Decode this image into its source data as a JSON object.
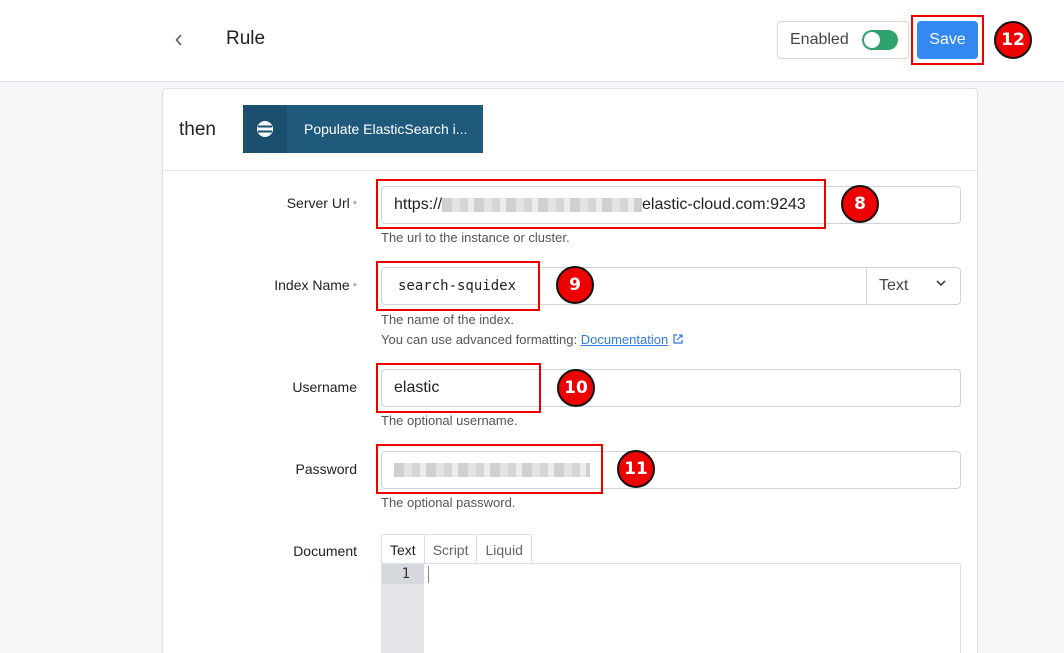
{
  "header": {
    "back_icon": "chevron-left-icon",
    "title": "Rule",
    "enabled_label": "Enabled",
    "enabled": true,
    "save_label": "Save"
  },
  "card": {
    "then_label": "then",
    "action_label": "Populate ElasticSearch i...",
    "action_icon": "elasticsearch-icon",
    "action_color": "#1f5a7c"
  },
  "fields": {
    "server_url": {
      "label": "Server Url",
      "required": "*",
      "value_prefix": "https://",
      "value_suffix": "elastic-cloud.com:9243",
      "hint": "The url to the instance or cluster."
    },
    "index_name": {
      "label": "Index Name",
      "required": "*",
      "value": "search-squidex",
      "type": "Text",
      "hint": "The name of the index.",
      "hint2": "You can use advanced formatting:",
      "doc_link": "Documentation"
    },
    "username": {
      "label": "Username",
      "value": "elastic",
      "hint": "The optional username."
    },
    "password": {
      "label": "Password",
      "hint": "The optional password."
    },
    "document": {
      "label": "Document",
      "tabs": [
        "Text",
        "Script",
        "Liquid"
      ],
      "active_tab": "Text",
      "line_number": "1"
    }
  },
  "annotations": {
    "badge_8": "8",
    "badge_9": "9",
    "badge_10": "10",
    "badge_11": "11",
    "badge_12": "12",
    "highlight_color": "#ee0000"
  },
  "colors": {
    "accent": "#3389f0",
    "toggle_on": "#2fa36b"
  }
}
